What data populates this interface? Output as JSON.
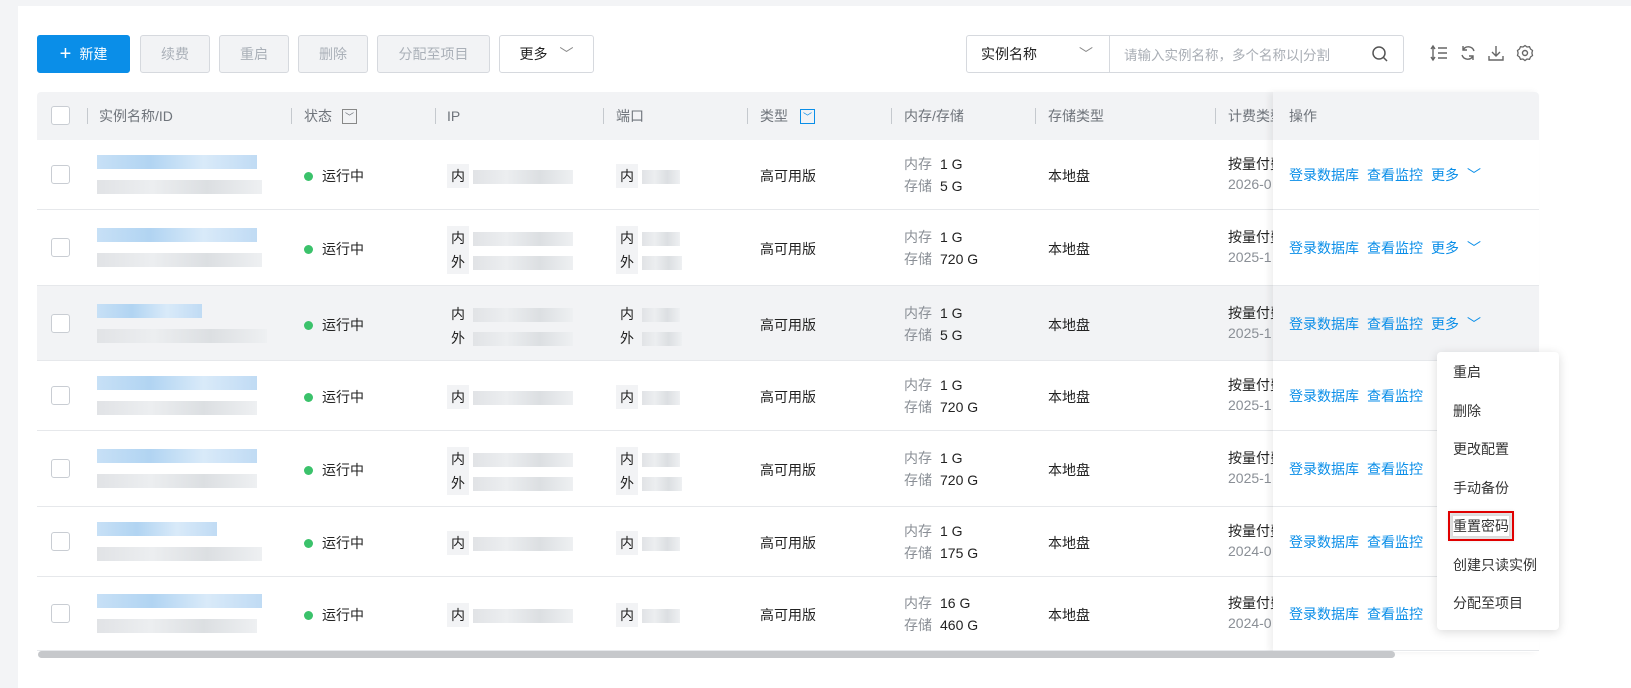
{
  "toolbar": {
    "new_label": "新建",
    "renew_label": "续费",
    "restart_label": "重启",
    "delete_label": "删除",
    "assign_label": "分配至项目",
    "more_label": "更多"
  },
  "search": {
    "field": "实例名称",
    "placeholder": "请输入实例名称，多个名称以|分割"
  },
  "columns": {
    "name": "实例名称/ID",
    "status": "状态",
    "ip": "IP",
    "port": "端口",
    "type": "类型",
    "mem": "内存/存储",
    "storage_type": "存储类型",
    "billing": "计费类型",
    "ops": "操作"
  },
  "labels": {
    "inner": "内",
    "outer": "外",
    "mem": "内存",
    "disk": "存储",
    "login": "登录数据库",
    "monitor": "查看监控",
    "more": "更多"
  },
  "rows": [
    {
      "status": "运行中",
      "type": "高可用版",
      "mem": "1 G",
      "disk": "5 G",
      "storage_type": "本地盘",
      "billing": "按量付费",
      "date": "2026-0",
      "outer": false
    },
    {
      "status": "运行中",
      "type": "高可用版",
      "mem": "1 G",
      "disk": "720 G",
      "storage_type": "本地盘",
      "billing": "按量付费",
      "date": "2025-1",
      "outer": true
    },
    {
      "status": "运行中",
      "type": "高可用版",
      "mem": "1 G",
      "disk": "5 G",
      "storage_type": "本地盘",
      "billing": "按量付费",
      "date": "2025-1",
      "outer": true
    },
    {
      "status": "运行中",
      "type": "高可用版",
      "mem": "1 G",
      "disk": "720 G",
      "storage_type": "本地盘",
      "billing": "按量付费",
      "date": "2025-1",
      "outer": false
    },
    {
      "status": "运行中",
      "type": "高可用版",
      "mem": "1 G",
      "disk": "720 G",
      "storage_type": "本地盘",
      "billing": "按量付费",
      "date": "2025-1",
      "outer": true
    },
    {
      "status": "运行中",
      "type": "高可用版",
      "mem": "1 G",
      "disk": "175 G",
      "storage_type": "本地盘",
      "billing": "按量付费",
      "date": "2024-0",
      "outer": false
    },
    {
      "status": "运行中",
      "type": "高可用版",
      "mem": "16 G",
      "disk": "460 G",
      "storage_type": "本地盘",
      "billing": "按量付费",
      "date": "2024-0",
      "outer": false
    }
  ],
  "more_menu": [
    "重启",
    "删除",
    "更改配置",
    "手动备份",
    "重置密码",
    "创建只读实例",
    "分配至项目"
  ],
  "highlighted_menu_item": "重置密码",
  "colors": {
    "primary": "#0a8ee8",
    "running": "#3bc26b",
    "highlight": "#e00000"
  }
}
